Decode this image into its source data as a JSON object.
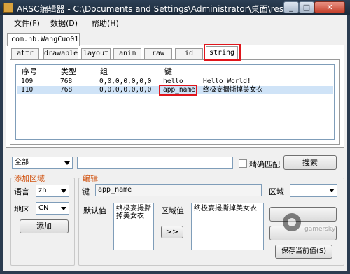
{
  "window": {
    "title": "ARSC编辑器 - C:\\Documents and Settings\\Administrator\\桌面\\resourc...",
    "minimize": "_",
    "maximize": "□",
    "close": "✕"
  },
  "menu": [
    "文件(F)",
    "数据(D)",
    "帮助(H)"
  ],
  "file_tab": "com.nb.WangCuo01",
  "resource_tabs": [
    "attr",
    "drawable",
    "layout",
    "anim",
    "raw",
    "id",
    "string"
  ],
  "active_tab": "string",
  "list": {
    "columns": [
      "序号",
      "类型",
      "组",
      "键"
    ],
    "rows": [
      {
        "index": "109",
        "type": "768",
        "group": "0,0,0,0,0,0,0",
        "key": "hello",
        "value": "Hello World!"
      },
      {
        "index": "110",
        "type": "768",
        "group": "0,0,0,0,0,0,0",
        "key": "app_name",
        "value": "终极妄撮撕掉美女衣"
      }
    ],
    "selected_row": 1
  },
  "filter": {
    "scope_value": "全部",
    "search_text": "",
    "exact_match_label": "精确匹配",
    "search_button": "搜索"
  },
  "add_region": {
    "title": "添加区域",
    "language_label": "语言",
    "language_value": "zh",
    "region_label": "地区",
    "region_value": "CN",
    "add_button": "添加"
  },
  "editor": {
    "title": "编辑",
    "key_label": "键",
    "key_value": "app_name",
    "region_label": "区域",
    "region_value": "",
    "default_label": "默认值",
    "default_value": "终极妄撮撕掉美女衣",
    "region_value_label": "区域值",
    "region_value_text": "终极妄撮撕掉美女衣",
    "copy_button": ">>",
    "save_button": "保存当前值(S)"
  },
  "watermark": "gamersky",
  "colors": {
    "highlight": "#e0151b",
    "group_title": "#d1520f",
    "selection": "#cfe3f7"
  }
}
